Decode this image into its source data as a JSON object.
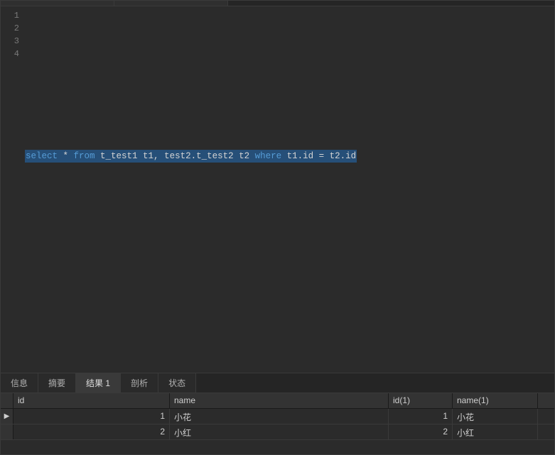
{
  "editor": {
    "line_numbers": [
      "1",
      "2",
      "3",
      "4"
    ],
    "sql_tokens": {
      "kw_select": "select",
      "star": " * ",
      "kw_from": "from",
      "tables": " t_test1 t1, test2.t_test2 t2 ",
      "kw_where": "where",
      "cond": " t1.id = t2.id"
    }
  },
  "tabs": {
    "info": "信息",
    "summary": "摘要",
    "result1": "结果 1",
    "profile": "剖析",
    "status": "状态"
  },
  "grid": {
    "headers": {
      "id": "id",
      "name": "name",
      "id1": "id(1)",
      "name1": "name(1)"
    },
    "rows": [
      {
        "marker": "▶",
        "id": "1",
        "name": "小花",
        "id1": "1",
        "name1": "小花"
      },
      {
        "marker": "",
        "id": "2",
        "name": "小红",
        "id1": "2",
        "name1": "小红"
      }
    ]
  }
}
